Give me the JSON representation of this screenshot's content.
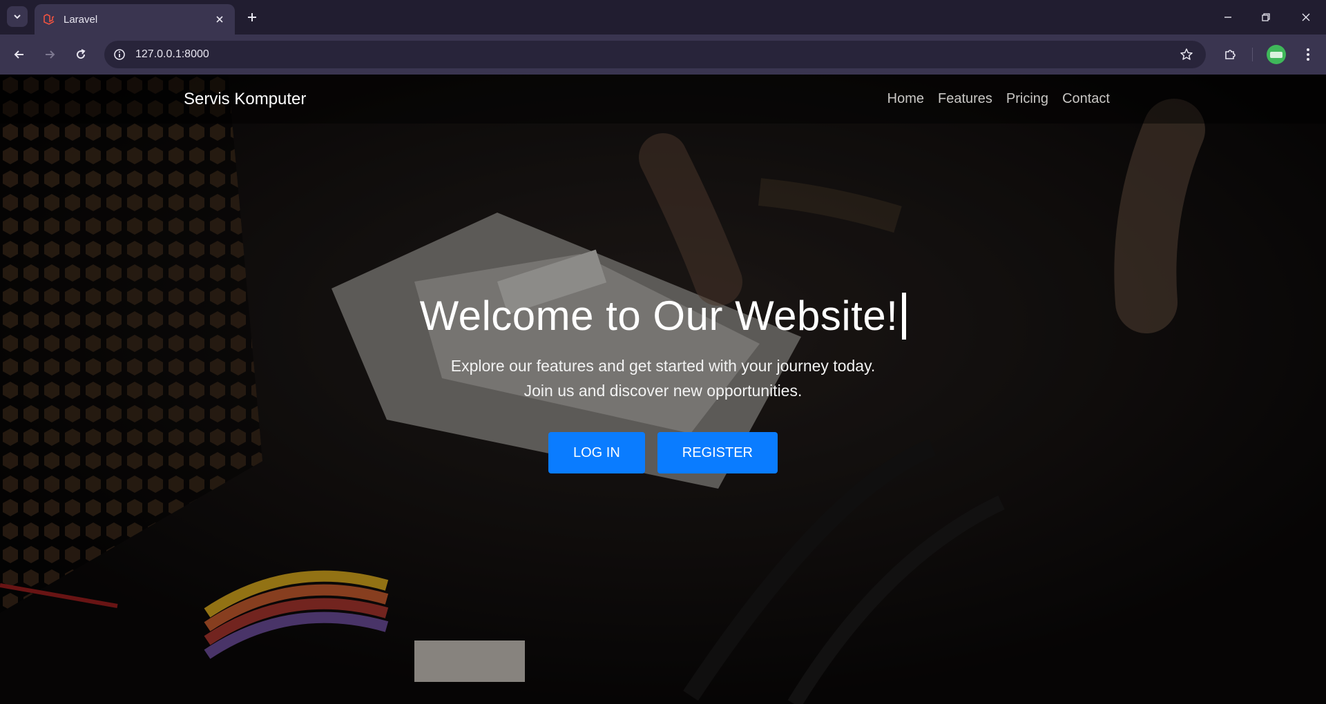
{
  "browser": {
    "tab_title": "Laravel",
    "url": "127.0.0.1:8000"
  },
  "icons": {
    "tab_search": "chevron-down-icon",
    "favicon": "laravel-icon",
    "tab_close": "close-icon",
    "new_tab": "plus-icon",
    "back": "arrow-left-icon",
    "forward": "arrow-right-icon",
    "reload": "reload-icon",
    "site_info": "info-icon",
    "bookmark": "star-icon",
    "extensions": "puzzle-icon",
    "menu": "kebab-menu-icon"
  },
  "site": {
    "brand": "Servis Komputer",
    "nav": [
      {
        "label": "Home"
      },
      {
        "label": "Features"
      },
      {
        "label": "Pricing"
      },
      {
        "label": "Contact"
      }
    ]
  },
  "hero": {
    "title": "Welcome to Our Website!",
    "subtitle_line1": "Explore our features and get started with your journey today.",
    "subtitle_line2": "Join us and discover new opportunities.",
    "login_label": "LOG IN",
    "register_label": "REGISTER"
  },
  "colors": {
    "button": "#0a7cff",
    "chrome_dark": "#211d30",
    "chrome_light": "#3a3550",
    "avatar": "#3fb85a"
  }
}
